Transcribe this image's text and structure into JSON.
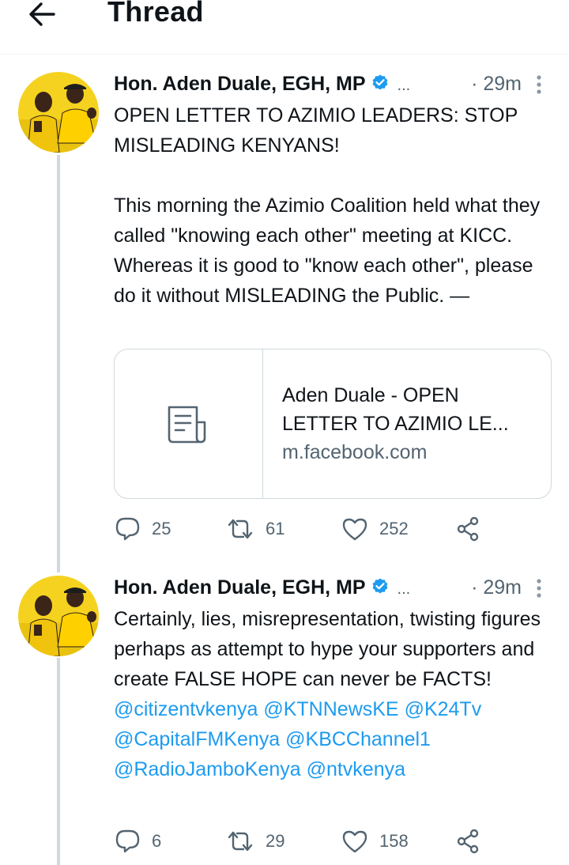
{
  "header": {
    "title": "Thread"
  },
  "tweets": [
    {
      "author": "Hon. Aden Duale, EGH, MP",
      "ellipsis": "...",
      "time": "· 29m",
      "paragraphs": [
        "OPEN LETTER TO AZIMIO LEADERS: STOP MISLEADING KENYANS!",
        "This morning the Azimio Coalition held what they called \"knowing each other\" meeting at KICC. Whereas it is good to \"know each other\", please do it without MISLEADING the Public. —"
      ],
      "card": {
        "title_line1": "Aden Duale - OPEN",
        "title_line2": "LETTER TO AZIMIO LE...",
        "domain": "m.facebook.com",
        "icon": "article-icon"
      },
      "replies": "25",
      "retweets": "61",
      "likes": "252"
    },
    {
      "author": "Hon. Aden Duale, EGH, MP",
      "ellipsis": "...",
      "time": "· 29m",
      "text": "Certainly, lies, misrepresentation, twisting figures perhaps as attempt  to hype your supporters and create FALSE  HOPE can never  be FACTS!",
      "mentions": [
        "@citizentvkenya",
        "@KTNNewsKE",
        "@K24Tv",
        "@CapitalFMKenya",
        "@KBCChannel1",
        "@RadioJamboKenya",
        "@ntvkenya"
      ],
      "replies": "6",
      "retweets": "29",
      "likes": "158"
    }
  ],
  "colors": {
    "accent": "#1d9bf0",
    "muted": "#536471",
    "thread_line": "#cfd9de",
    "avatar_bg": "#f5d21f"
  }
}
